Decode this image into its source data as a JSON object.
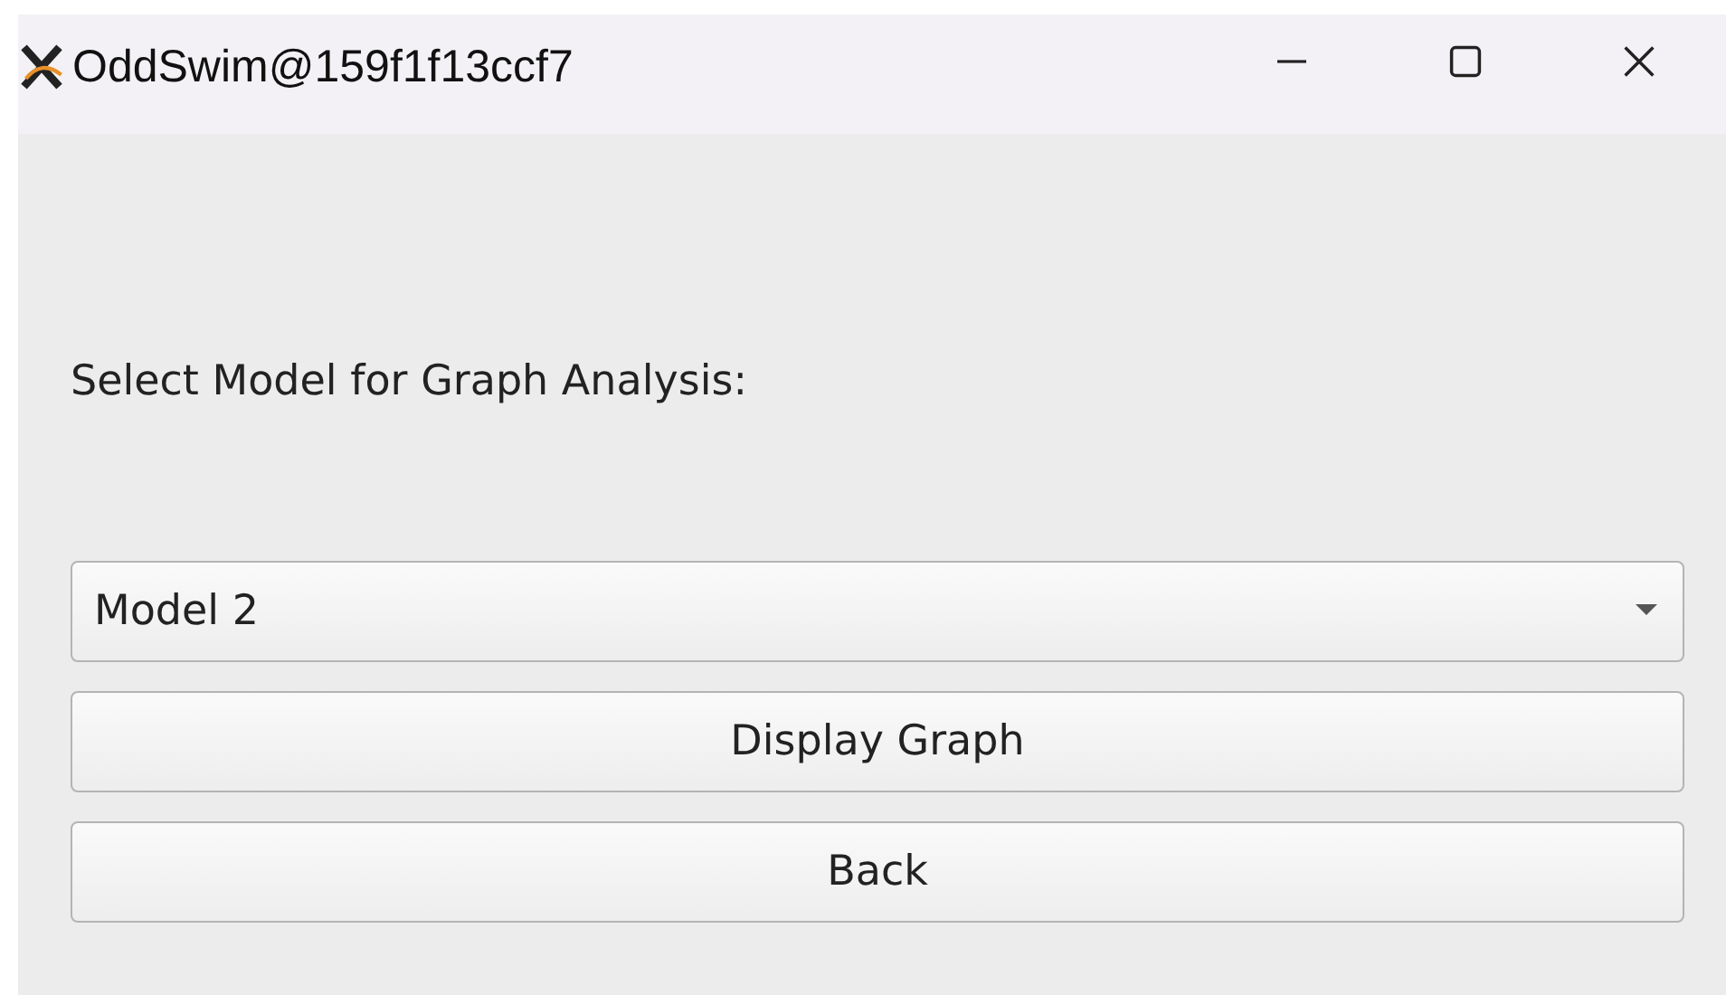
{
  "window": {
    "title": "OddSwim@159f1f13ccf7"
  },
  "prompt": "Select Model for Graph Analysis:",
  "model_select": {
    "value": "Model 2"
  },
  "buttons": [
    "Display Graph",
    "Back"
  ]
}
